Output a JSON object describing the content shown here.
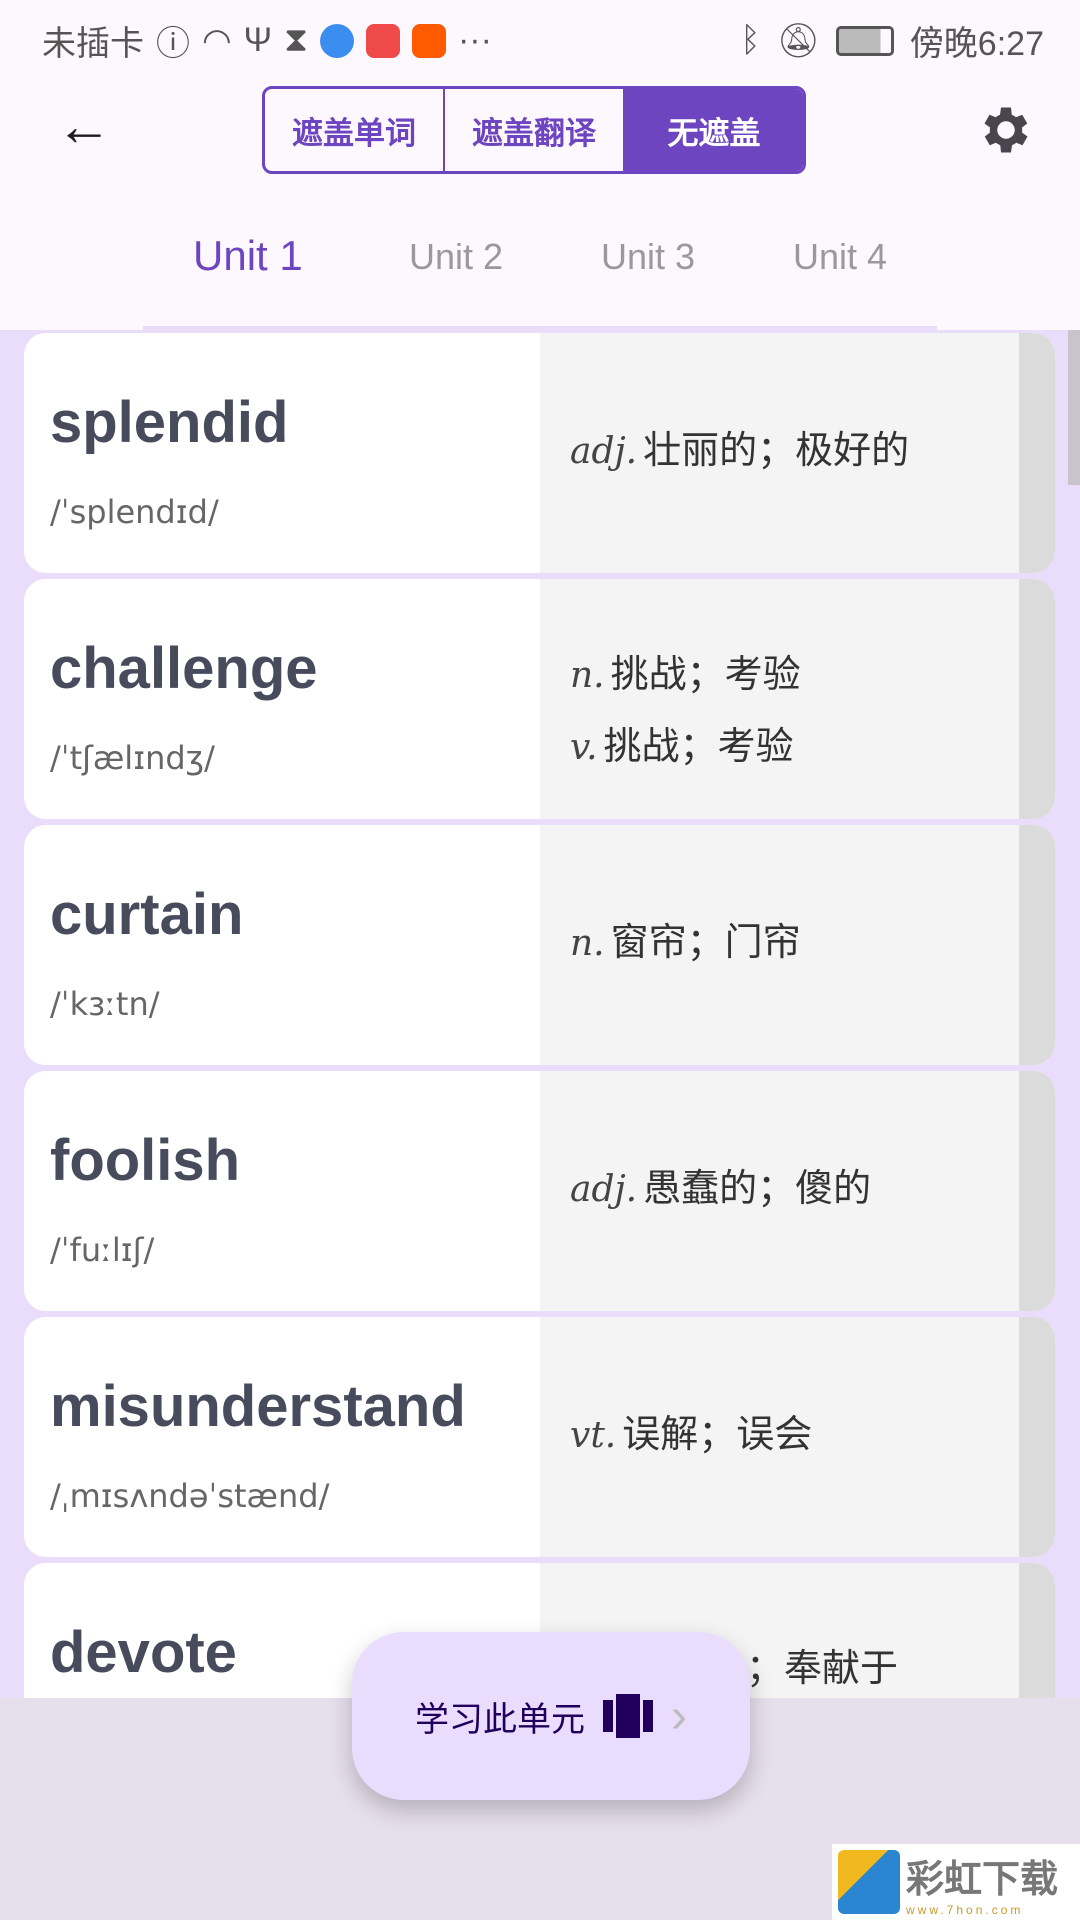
{
  "status": {
    "carrier": "未插卡",
    "time": "傍晚6:27",
    "more": "···"
  },
  "header": {
    "modes": [
      "遮盖单词",
      "遮盖翻译",
      "无遮盖"
    ],
    "active_mode": 2,
    "accent": "#6e45c0"
  },
  "tabs": [
    "Unit 1",
    "Unit 2",
    "Unit 3",
    "Unit 4"
  ],
  "active_tab": 0,
  "words": [
    {
      "word": "splendid",
      "phonetic": "/ˈsplendɪd/",
      "meanings": [
        {
          "pos": "adj.",
          "text": "壮丽的；极好的"
        }
      ]
    },
    {
      "word": "challenge",
      "phonetic": "/ˈtʃælɪndʒ/",
      "meanings": [
        {
          "pos": "n.",
          "text": "挑战；考验"
        },
        {
          "pos": "v.",
          "text": "挑战；考验"
        }
      ]
    },
    {
      "word": "curtain",
      "phonetic": "/ˈkɜːtn/",
      "meanings": [
        {
          "pos": "n.",
          "text": "窗帘；门帘"
        }
      ]
    },
    {
      "word": "foolish",
      "phonetic": "/ˈfuːlɪʃ/",
      "meanings": [
        {
          "pos": "adj.",
          "text": "愚蠢的；傻的"
        }
      ]
    },
    {
      "word": "misunderstand",
      "phonetic": "/ˌmɪsʌndəˈstænd/",
      "meanings": [
        {
          "pos": "vt.",
          "text": "误解；误会"
        }
      ]
    },
    {
      "word": "devote",
      "phonetic": "",
      "meanings": [
        {
          "pos": "",
          "text": "；奉献于"
        }
      ]
    }
  ],
  "fab": {
    "label": "学习此单元"
  },
  "watermark": {
    "name": "彩虹下载",
    "url": "www.7hon.com"
  }
}
